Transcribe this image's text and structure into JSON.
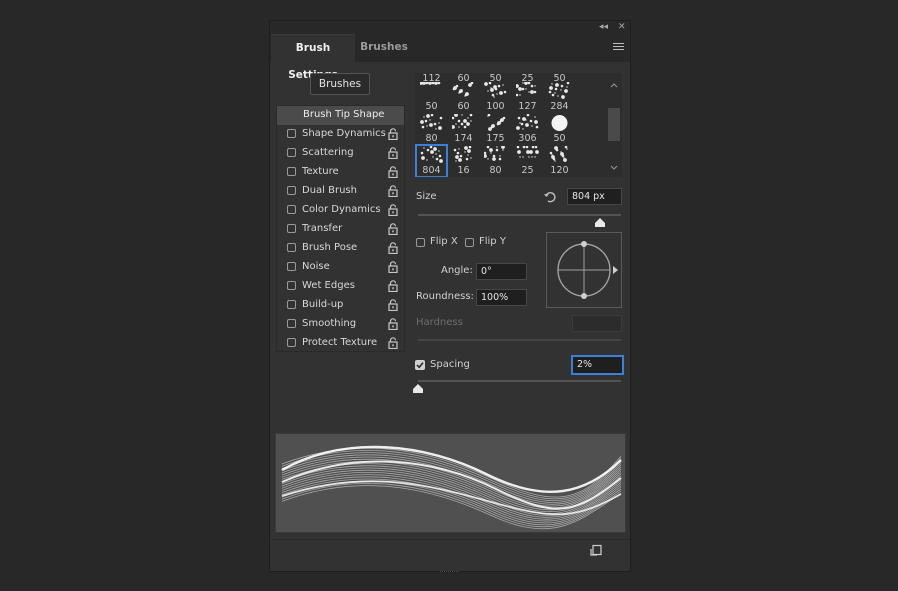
{
  "window_controls": {
    "collapse": "◂◂",
    "close": "✕"
  },
  "tabs": [
    {
      "label": "Brush Settings",
      "active": true
    },
    {
      "label": "Brushes",
      "active": false
    }
  ],
  "brushes_button": "Brushes",
  "options": [
    {
      "label": "Brush Tip Shape",
      "selected": true,
      "checkbox": false,
      "lock": false
    },
    {
      "label": "Shape Dynamics",
      "checked": false,
      "lock": true
    },
    {
      "label": "Scattering",
      "checked": false,
      "lock": true
    },
    {
      "label": "Texture",
      "checked": false,
      "lock": true
    },
    {
      "label": "Dual Brush",
      "checked": false,
      "lock": true
    },
    {
      "label": "Color Dynamics",
      "checked": false,
      "lock": true
    },
    {
      "label": "Transfer",
      "checked": false,
      "lock": true
    },
    {
      "label": "Brush Pose",
      "checked": false,
      "lock": true
    },
    {
      "label": "Noise",
      "checked": false,
      "lock": true
    },
    {
      "label": "Wet Edges",
      "checked": false,
      "lock": true
    },
    {
      "label": "Build-up",
      "checked": false,
      "lock": true
    },
    {
      "label": "Smoothing",
      "checked": false,
      "lock": true
    },
    {
      "label": "Protect Texture",
      "checked": false,
      "lock": true
    }
  ],
  "brush_tips": {
    "partial_top_row": [
      "112",
      "60",
      "50",
      "25",
      "50"
    ],
    "rows": [
      [
        "50",
        "60",
        "100",
        "127",
        "284"
      ],
      [
        "80",
        "174",
        "175",
        "306",
        "50"
      ],
      [
        "804",
        "16",
        "80",
        "25",
        "120"
      ]
    ],
    "selected": "804"
  },
  "size": {
    "label": "Size",
    "value": "804 px",
    "slider_fraction": 0.92
  },
  "flip_x": {
    "label": "Flip X",
    "checked": false
  },
  "flip_y": {
    "label": "Flip Y",
    "checked": false
  },
  "angle": {
    "label": "Angle:",
    "value": "0°"
  },
  "roundness": {
    "label": "Roundness:",
    "value": "100%"
  },
  "hardness": {
    "label": "Hardness",
    "value": "",
    "enabled": false
  },
  "spacing": {
    "label": "Spacing",
    "checked": true,
    "value": "2%",
    "slider_fraction": 0.0
  },
  "colors": {
    "panel": "#323232",
    "tab_bar": "#282828",
    "accent": "#3c7fd8",
    "preview_bg": "#505050"
  }
}
